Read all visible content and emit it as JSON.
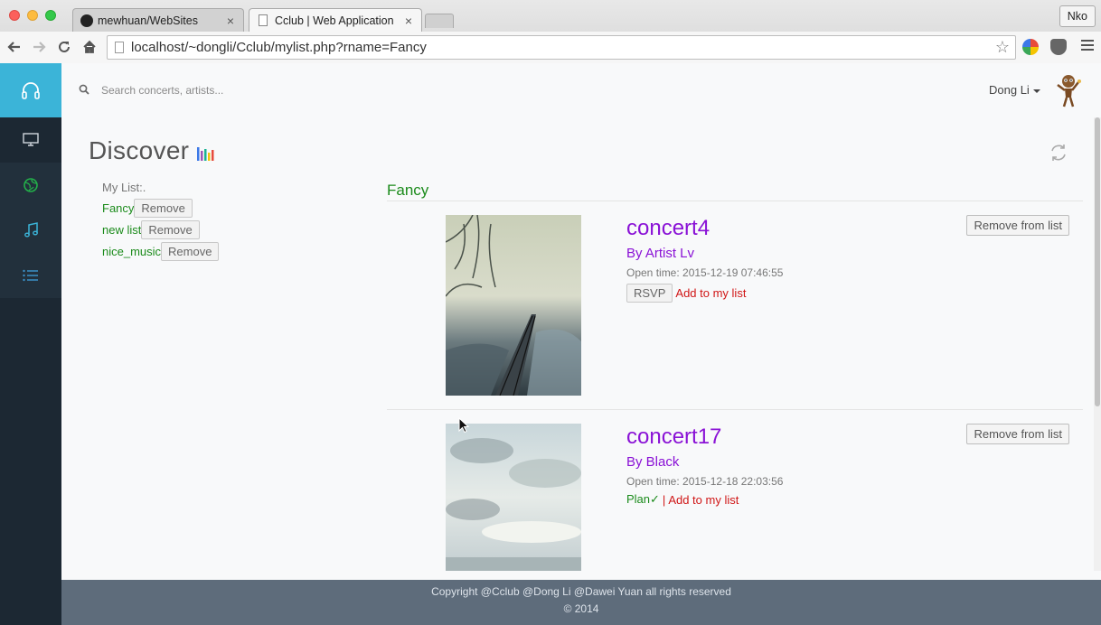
{
  "browser": {
    "tabs": [
      {
        "title": "mewhuan/WebSites",
        "close": "×"
      },
      {
        "title": "Cclub | Web Application",
        "close": "×"
      }
    ],
    "profile": "Nko",
    "url": "localhost/~dongli/Cclub/mylist.php?rname=Fancy"
  },
  "header": {
    "search_placeholder": "Search concerts, artists...",
    "user_name": "Dong Li"
  },
  "page": {
    "title": "Discover"
  },
  "my_list": {
    "label": "My List:.",
    "remove_label": "Remove",
    "items": [
      {
        "name": "Fancy"
      },
      {
        "name": "new list"
      },
      {
        "name": "nice_music"
      }
    ]
  },
  "current_list": {
    "name": "Fancy",
    "remove_from_list_label": "Remove from list",
    "concerts": [
      {
        "name": "concert4",
        "artist": "By Artist Lv",
        "open_time": "Open time: 2015-12-19 07:46:55",
        "rsvp_label": "RSVP",
        "add_label": "Add to my list"
      },
      {
        "name": "concert17",
        "artist": "By Black",
        "open_time": "Open time: 2015-12-18 22:03:56",
        "plan_label": "Plan✓",
        "separator": "|",
        "add_label": "Add to my list"
      }
    ]
  },
  "footer": {
    "copyright": "Copyright @Cclub @Dong Li @Dawei Yuan all rights reserved",
    "year": "© 2014"
  },
  "colors": {
    "sidebar_bg": "#1c2833",
    "accent": "#3bb4d8",
    "concert_name": "#8a12d6",
    "list_link": "#1b8b1b",
    "add_link": "#d01616",
    "footer_bg": "#5e6c7b"
  }
}
